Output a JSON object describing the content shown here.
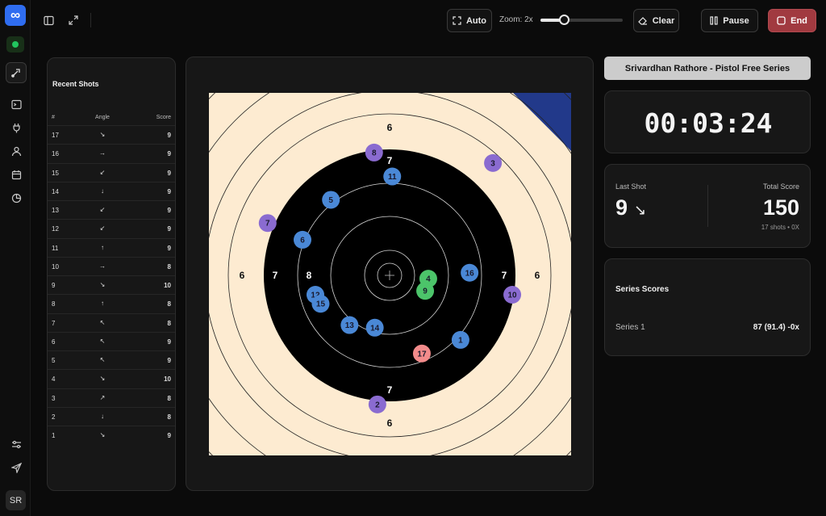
{
  "sidebar": {
    "logo": "∞",
    "avatar": "SR",
    "icons": [
      "status-dot",
      "target-shoot-icon",
      "terminal-icon",
      "plug-icon",
      "user-icon",
      "calendar-icon",
      "pie-chart-icon",
      "settings-sliders-icon",
      "send-icon"
    ]
  },
  "toolbar": {
    "auto_label": "Auto",
    "zoom_label": "Zoom: 2x",
    "zoom_level": 0.28,
    "clear_label": "Clear",
    "pause_label": "Pause",
    "end_label": "End"
  },
  "recent_shots": {
    "title": "Recent Shots",
    "headers": {
      "num": "#",
      "angle": "Angle",
      "score": "Score"
    },
    "rows": [
      {
        "num": "17",
        "angle": "↘",
        "score": "9"
      },
      {
        "num": "16",
        "angle": "→",
        "score": "9"
      },
      {
        "num": "15",
        "angle": "↙",
        "score": "9"
      },
      {
        "num": "14",
        "angle": "↓",
        "score": "9"
      },
      {
        "num": "13",
        "angle": "↙",
        "score": "9"
      },
      {
        "num": "12",
        "angle": "↙",
        "score": "9"
      },
      {
        "num": "11",
        "angle": "↑",
        "score": "9"
      },
      {
        "num": "10",
        "angle": "→",
        "score": "8"
      },
      {
        "num": "9",
        "angle": "↘",
        "score": "10"
      },
      {
        "num": "8",
        "angle": "↑",
        "score": "8"
      },
      {
        "num": "7",
        "angle": "↖",
        "score": "8"
      },
      {
        "num": "6",
        "angle": "↖",
        "score": "9"
      },
      {
        "num": "5",
        "angle": "↖",
        "score": "9"
      },
      {
        "num": "4",
        "angle": "↘",
        "score": "10"
      },
      {
        "num": "3",
        "angle": "↗",
        "score": "8"
      },
      {
        "num": "2",
        "angle": "↓",
        "score": "8"
      },
      {
        "num": "1",
        "angle": "↘",
        "score": "9"
      }
    ]
  },
  "target": {
    "ring_labels": [
      "6",
      "7",
      "8"
    ],
    "shots": [
      {
        "n": "1",
        "dx": 4.07,
        "dy": -3.7,
        "color": "#4a88d6"
      },
      {
        "n": "2",
        "dx": -0.7,
        "dy": -7.4,
        "color": "#8a6bd0"
      },
      {
        "n": "3",
        "dx": 5.93,
        "dy": 6.44,
        "color": "#8a6bd0"
      },
      {
        "n": "4",
        "dx": 2.22,
        "dy": -0.19,
        "color": "#4cc46a"
      },
      {
        "n": "5",
        "dx": -3.37,
        "dy": 4.33,
        "color": "#4a88d6"
      },
      {
        "n": "6",
        "dx": -5.0,
        "dy": 2.04,
        "color": "#4a88d6"
      },
      {
        "n": "7",
        "dx": -7.0,
        "dy": 3.0,
        "color": "#8a6bd0"
      },
      {
        "n": "8",
        "dx": -0.89,
        "dy": 7.04,
        "color": "#8a6bd0"
      },
      {
        "n": "9",
        "dx": 2.04,
        "dy": -0.89,
        "color": "#4cc46a"
      },
      {
        "n": "10",
        "dx": 7.04,
        "dy": -1.11,
        "color": "#8a6bd0"
      },
      {
        "n": "11",
        "dx": 0.15,
        "dy": 5.67,
        "color": "#4a88d6"
      },
      {
        "n": "12",
        "dx": -4.26,
        "dy": -1.11,
        "color": "#4a88d6"
      },
      {
        "n": "13",
        "dx": -2.3,
        "dy": -2.85,
        "color": "#4a88d6"
      },
      {
        "n": "14",
        "dx": -0.85,
        "dy": -3.0,
        "color": "#4a88d6"
      },
      {
        "n": "15",
        "dx": -3.96,
        "dy": -1.63,
        "color": "#4a88d6"
      },
      {
        "n": "16",
        "dx": 4.59,
        "dy": 0.15,
        "color": "#4a88d6"
      },
      {
        "n": "17",
        "dx": 1.85,
        "dy": -4.48,
        "color": "#f28b8b"
      }
    ]
  },
  "session": {
    "name": "Srivardhan Rathore - Pistol Free Series",
    "timer": "00:03:24",
    "last_shot_label": "Last Shot",
    "last_shot_value": "9",
    "last_shot_arrow": "↘",
    "total_label": "Total Score",
    "total_value": "150",
    "total_sub": "17 shots • 0X",
    "series_title": "Series Scores",
    "series": [
      {
        "name": "Series 1",
        "value": "87 (91.4) -0x"
      }
    ]
  },
  "colors": {
    "accent": "#2f6df0",
    "end_button": "#a13a40",
    "target_paper": "#fdebd1",
    "target_black": "#000000",
    "corner_flag": "#22398a"
  }
}
